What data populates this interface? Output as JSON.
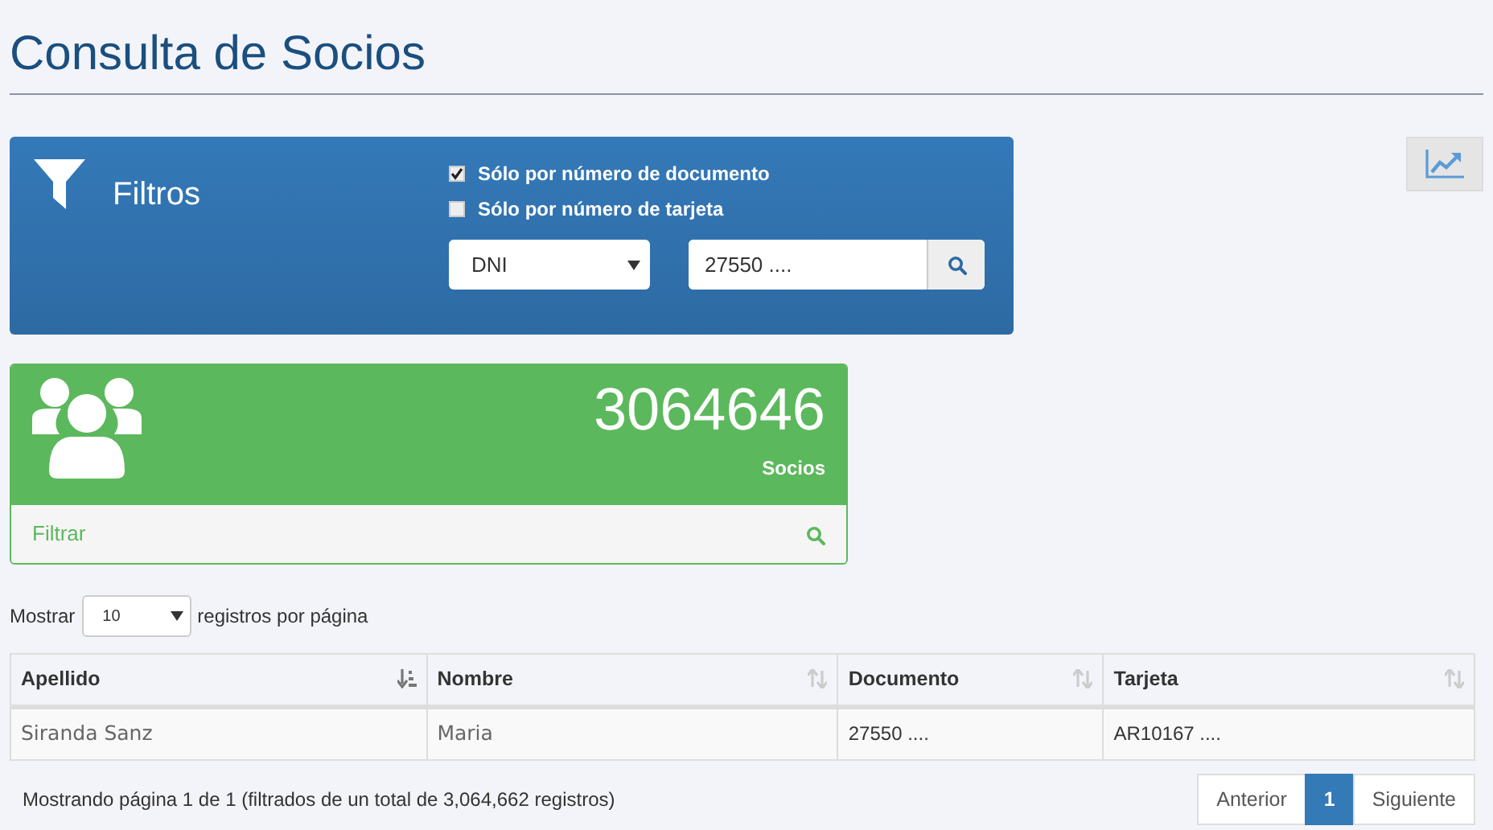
{
  "title": "Consulta de Socios",
  "filters": {
    "title": "Filtros",
    "checkboxes": [
      {
        "label": "Sólo por número de documento",
        "checked": true
      },
      {
        "label": "Sólo por número de tarjeta",
        "checked": false
      }
    ],
    "select": {
      "value": "DNI"
    },
    "search": {
      "value": "27550 ...."
    }
  },
  "stats": {
    "count": "3064646",
    "label": "Socios",
    "footer_link": "Filtrar"
  },
  "length": {
    "before": "Mostrar",
    "value": "10",
    "after": "registros por página"
  },
  "table": {
    "columns": [
      {
        "label": "Apellido",
        "sorted": true
      },
      {
        "label": "Nombre",
        "sorted": false
      },
      {
        "label": "Documento",
        "sorted": false
      },
      {
        "label": "Tarjeta",
        "sorted": false
      }
    ],
    "rows": [
      [
        "Siranda Sanz",
        "Maria",
        "27550 ....",
        "AR10167 ...."
      ]
    ]
  },
  "info": "Mostrando página 1 de 1 (filtrados de un total de 3,064,662 registros)",
  "pagination": [
    {
      "label": "Anterior",
      "selected": false
    },
    {
      "label": "1",
      "selected": true
    },
    {
      "label": "Siguiente",
      "selected": false
    }
  ]
}
